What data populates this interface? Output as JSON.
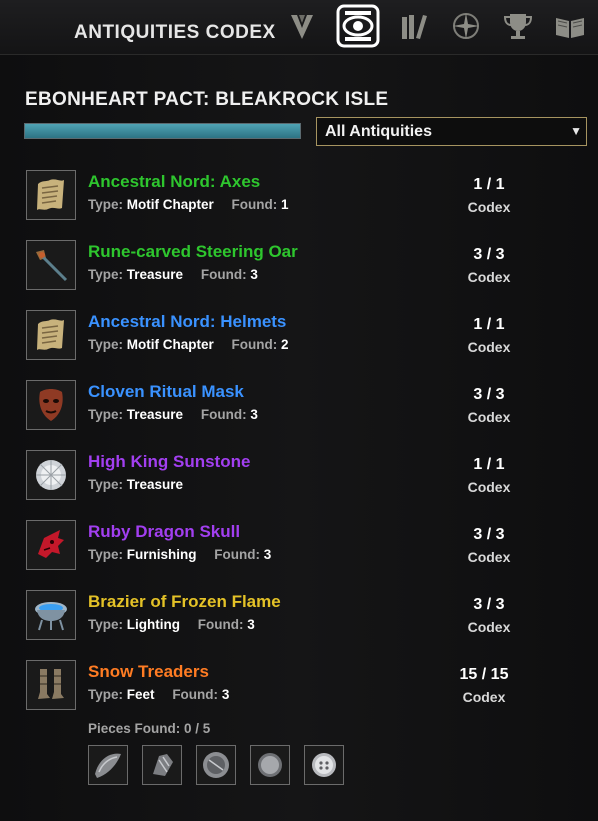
{
  "header": {
    "title": "ANTIQUITIES CODEX",
    "nav_icons": [
      {
        "name": "chevron-emblem-icon",
        "active": false
      },
      {
        "name": "antiquities-scrying-icon",
        "active": true
      },
      {
        "name": "collection-books-icon",
        "active": false
      },
      {
        "name": "compass-star-icon",
        "active": false
      },
      {
        "name": "trophy-icon",
        "active": false
      },
      {
        "name": "open-book-icon",
        "active": false
      }
    ]
  },
  "zone": {
    "title": "EBONHEART PACT: BLEAKROCK ISLE",
    "progress": 1.0
  },
  "filter": {
    "selected": "All Antiquities"
  },
  "labels": {
    "type": "Type:",
    "found": "Found:",
    "codex": "Codex"
  },
  "items": [
    {
      "name": "Ancestral Nord: Axes",
      "color": "#2ec62e",
      "type": "Motif Chapter",
      "found": "1",
      "count": "1 / 1",
      "icon": "scroll-icon"
    },
    {
      "name": "Rune-carved Steering Oar",
      "color": "#2ec62e",
      "type": "Treasure",
      "found": "3",
      "count": "3 / 3",
      "icon": "oar-icon"
    },
    {
      "name": "Ancestral Nord: Helmets",
      "color": "#3a92ff",
      "type": "Motif Chapter",
      "found": "2",
      "count": "1 / 1",
      "icon": "scroll-icon"
    },
    {
      "name": "Cloven Ritual Mask",
      "color": "#3a92ff",
      "type": "Treasure",
      "found": "3",
      "count": "3 / 3",
      "icon": "mask-icon"
    },
    {
      "name": "High King Sunstone",
      "color": "#a23ff0",
      "type": "Treasure",
      "found": "",
      "count": "1 / 1",
      "icon": "gem-icon"
    },
    {
      "name": "Ruby Dragon Skull",
      "color": "#a23ff0",
      "type": "Furnishing",
      "found": "3",
      "count": "3 / 3",
      "icon": "dragon-skull-icon"
    },
    {
      "name": "Brazier of Frozen Flame",
      "color": "#e4c227",
      "type": "Lighting",
      "found": "3",
      "count": "3 / 3",
      "icon": "brazier-icon"
    },
    {
      "name": "Snow Treaders",
      "color": "#ff7c23",
      "type": "Feet",
      "found": "3",
      "count": "15 / 15",
      "icon": "boots-icon"
    }
  ],
  "pieces": {
    "label": "Pieces Found: 0 / 5",
    "icons": [
      "fragment-curved-icon",
      "fragment-shard-icon",
      "fragment-disc-icon",
      "fragment-bowl-icon",
      "fragment-button-icon"
    ]
  }
}
